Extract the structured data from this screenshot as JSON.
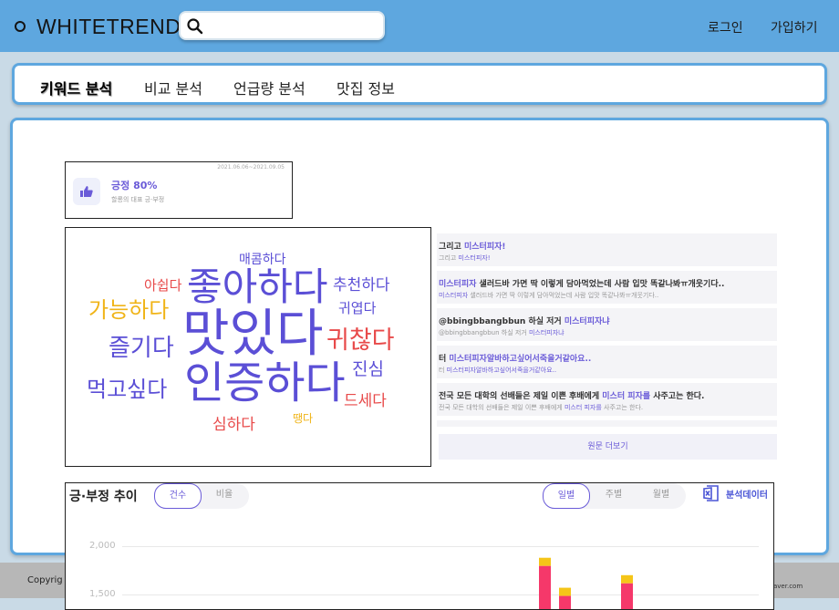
{
  "brand": "WHITETREND",
  "header": {
    "login": "로그인",
    "signup": "가입하기",
    "search_placeholder": ""
  },
  "tabs": [
    {
      "label": "키워드 분석",
      "active": true
    },
    {
      "label": "비교 분석",
      "active": false
    },
    {
      "label": "언급량 분석",
      "active": false
    },
    {
      "label": "맛집 정보",
      "active": false
    }
  ],
  "sentiment": {
    "date_range": "2021.06.06~2021.09.05",
    "label": "긍정",
    "percent": "80%",
    "sub": "할롱의 대표 긍·부정"
  },
  "word_cloud": [
    {
      "text": "매콤하다",
      "color": "#5b4fd6"
    },
    {
      "text": "아쉽다",
      "color": "#e84a4a"
    },
    {
      "text": "좋아하다",
      "color": "#5b4fd6"
    },
    {
      "text": "추천하다",
      "color": "#5b4fd6"
    },
    {
      "text": "가능하다",
      "color": "#f0b418"
    },
    {
      "text": "귀엽다",
      "color": "#5b4fd6"
    },
    {
      "text": "즐기다",
      "color": "#5b4fd6"
    },
    {
      "text": "맛있다",
      "color": "#5b4fd6"
    },
    {
      "text": "귀찮다",
      "color": "#e84a4a"
    },
    {
      "text": "진심",
      "color": "#5b4fd6"
    },
    {
      "text": "먹고싶다",
      "color": "#5b4fd6"
    },
    {
      "text": "인증하다",
      "color": "#5b4fd6"
    },
    {
      "text": "드세다",
      "color": "#e84a4a"
    },
    {
      "text": "심하다",
      "color": "#e84a4a"
    },
    {
      "text": "땡다",
      "color": "#f0b418"
    }
  ],
  "mentions": [
    {
      "title_pre": "그리고 ",
      "title_hl": "미스터피자!",
      "title_post": "",
      "sub_pre": "그리고 ",
      "sub_hl": "미스터피자!",
      "sub_post": ""
    },
    {
      "title_pre": "",
      "title_hl": "미스터피자",
      "title_post": " 샐러드바 가면 딱 이렇게 담아먹었는데 사람 입맛 똑같나봐ㅠ개웃기다..",
      "sub_pre": "",
      "sub_hl": "미스터피자",
      "sub_post": " 샐러드바 가면 딱 이렇게 담아먹었는데 사람 입맛 똑같나봐ㅠ개웃기다.."
    },
    {
      "title_pre": "@bbingbbangbbun 하실 저거 ",
      "title_hl": "미스터피자냐",
      "title_post": "",
      "sub_pre": "@bbingbbangbbun 하실 저거 ",
      "sub_hl": "미스터피자냐",
      "sub_post": ""
    },
    {
      "title_pre": "터 ",
      "title_hl": "미스터피자알바하고싶어서죽을거같아요..",
      "title_post": "",
      "sub_pre": "터 ",
      "sub_hl": "미스터피자알바하고싶어서죽을거같아요..",
      "sub_post": ""
    },
    {
      "title_pre": "전국 모든 대학의 선배들은 제일 이쁜 후배에게 ",
      "title_hl": "미스터 피자를",
      "title_post": " 사주고는 한다.",
      "sub_pre": "전국 모든 대학의 선배들은 제일 이쁜 후배에게 ",
      "sub_hl": "미스터 피자를",
      "sub_post": " 사주고는 한다."
    }
  ],
  "more_label": "원문 더보기",
  "trend": {
    "title": "긍·부정 추이",
    "metric_options": [
      "건수",
      "비율"
    ],
    "metric_selected": "건수",
    "period_options": [
      "일별",
      "주별",
      "월별"
    ],
    "period_selected": "일별",
    "export_label": "분석데이터"
  },
  "footer": {
    "copyright": "Copyrig",
    "credit": "aver.com"
  },
  "colors": {
    "header": "#5ea7df",
    "accent": "#6a5bd8",
    "positive": "#5b4fd6",
    "negative": "#e84a4a",
    "neutral": "#f0b418"
  },
  "chart_data": {
    "type": "bar",
    "title": "긍·부정 추이",
    "y_ticks_visible": [
      2000,
      1500
    ],
    "y_tick_labels": [
      "2,000",
      "1,500"
    ],
    "series": [
      {
        "color": "#f5386a"
      },
      {
        "color": "#f5c518"
      }
    ],
    "note": "only top portion of chart visible; bars partially cropped",
    "visible_bars": [
      {
        "stack_top": 1880,
        "color_segments": [
          "#f5386a",
          "#f5c518"
        ]
      },
      {
        "stack_top": 1570,
        "color_segments": [
          "#f5386a",
          "#f5c518"
        ]
      },
      {
        "stack_top": 1700,
        "color_segments": [
          "#f5386a",
          "#f5c518"
        ]
      }
    ]
  }
}
